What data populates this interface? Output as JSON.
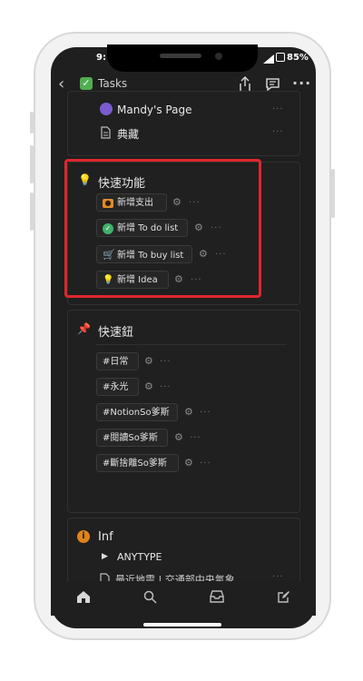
{
  "status_bar": {
    "time": "9:",
    "battery": "85%"
  },
  "nav": {
    "title": "Tasks"
  },
  "top_card": {
    "items": [
      {
        "label": "Mandy's Page",
        "icon": "avatar-icon"
      },
      {
        "label": "典藏",
        "icon": "page-icon"
      }
    ]
  },
  "quick_features": {
    "title": "快速功能",
    "buttons": [
      {
        "label": "新增支出",
        "icon": "cash-icon"
      },
      {
        "label": "新增 To do list",
        "icon": "check-circle-icon"
      },
      {
        "label": "新增 To buy list",
        "icon": "cart-icon"
      },
      {
        "label": "新增 Idea",
        "icon": "bulb-icon"
      }
    ]
  },
  "quick_buttons": {
    "title": "快速鈕",
    "buttons": [
      "#日常",
      "#永光",
      "#NotionSo爹斯",
      "#閱讀So爹斯",
      "#斷捨離So爹斯"
    ]
  },
  "inf": {
    "title": "Inf",
    "toggle_label": "ANYTYPE",
    "page_label": "最近地震 | 交通部中央氣象"
  },
  "colors": {
    "highlight": "#e0262c",
    "background": "#1f1f1f"
  }
}
